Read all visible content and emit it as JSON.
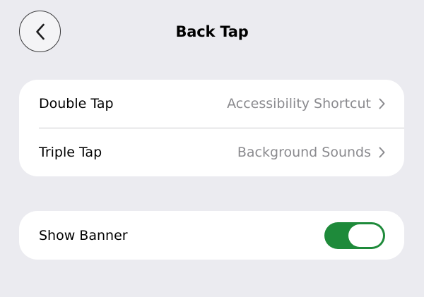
{
  "nav": {
    "title": "Back Tap",
    "back_icon": "chevron-left-icon"
  },
  "tap_group": {
    "rows": [
      {
        "label": "Double Tap",
        "value": "Accessibility Shortcut",
        "icon": "chevron-right-icon"
      },
      {
        "label": "Triple Tap",
        "value": "Background Sounds",
        "icon": "chevron-right-icon"
      }
    ]
  },
  "banner_group": {
    "label": "Show Banner",
    "toggle_on": true
  },
  "colors": {
    "background": "#ebebf0",
    "card": "#ffffff",
    "secondary_text": "#8a8a8e",
    "toggle_on": "#1e8a3a",
    "divider": "#c8c8cc"
  }
}
